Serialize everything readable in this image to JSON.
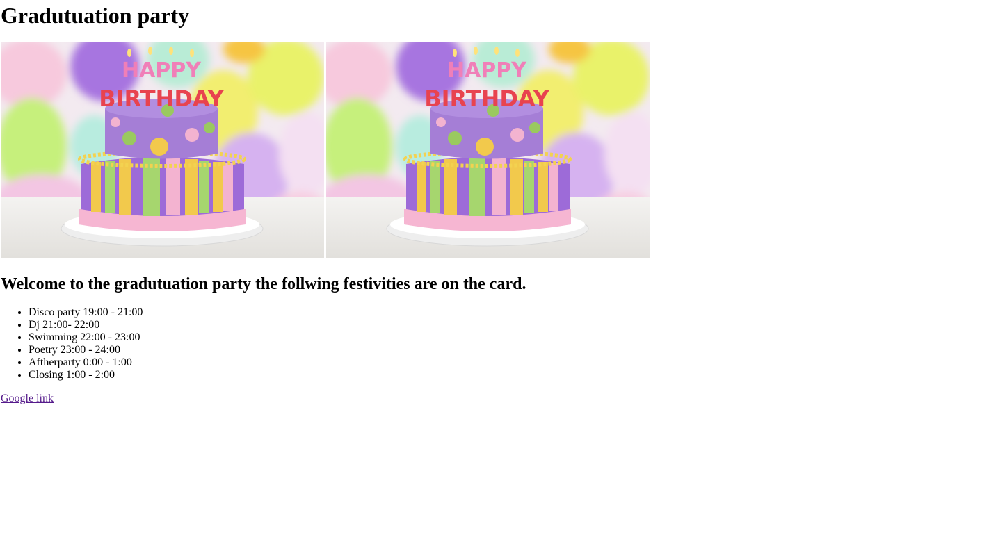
{
  "page": {
    "title": "Gradutuation party",
    "welcome": "Welcome to the gradutuation party the follwing festivities are on the card.",
    "cake_text_line1": "HAPPY",
    "cake_text_line2": "BIRTHDAY",
    "festivities": [
      "Disco party 19:00 - 21:00",
      "Dj 21:00- 22:00",
      "Swimming 22:00 - 23:00",
      "Poetry 23:00 - 24:00",
      "Aftherparty 0:00 - 1:00",
      "Closing 1:00 - 2:00"
    ],
    "link_text": "Google link"
  },
  "colors": {
    "link_visited": "#551a8b",
    "text": "#000000",
    "background": "#ffffff"
  }
}
